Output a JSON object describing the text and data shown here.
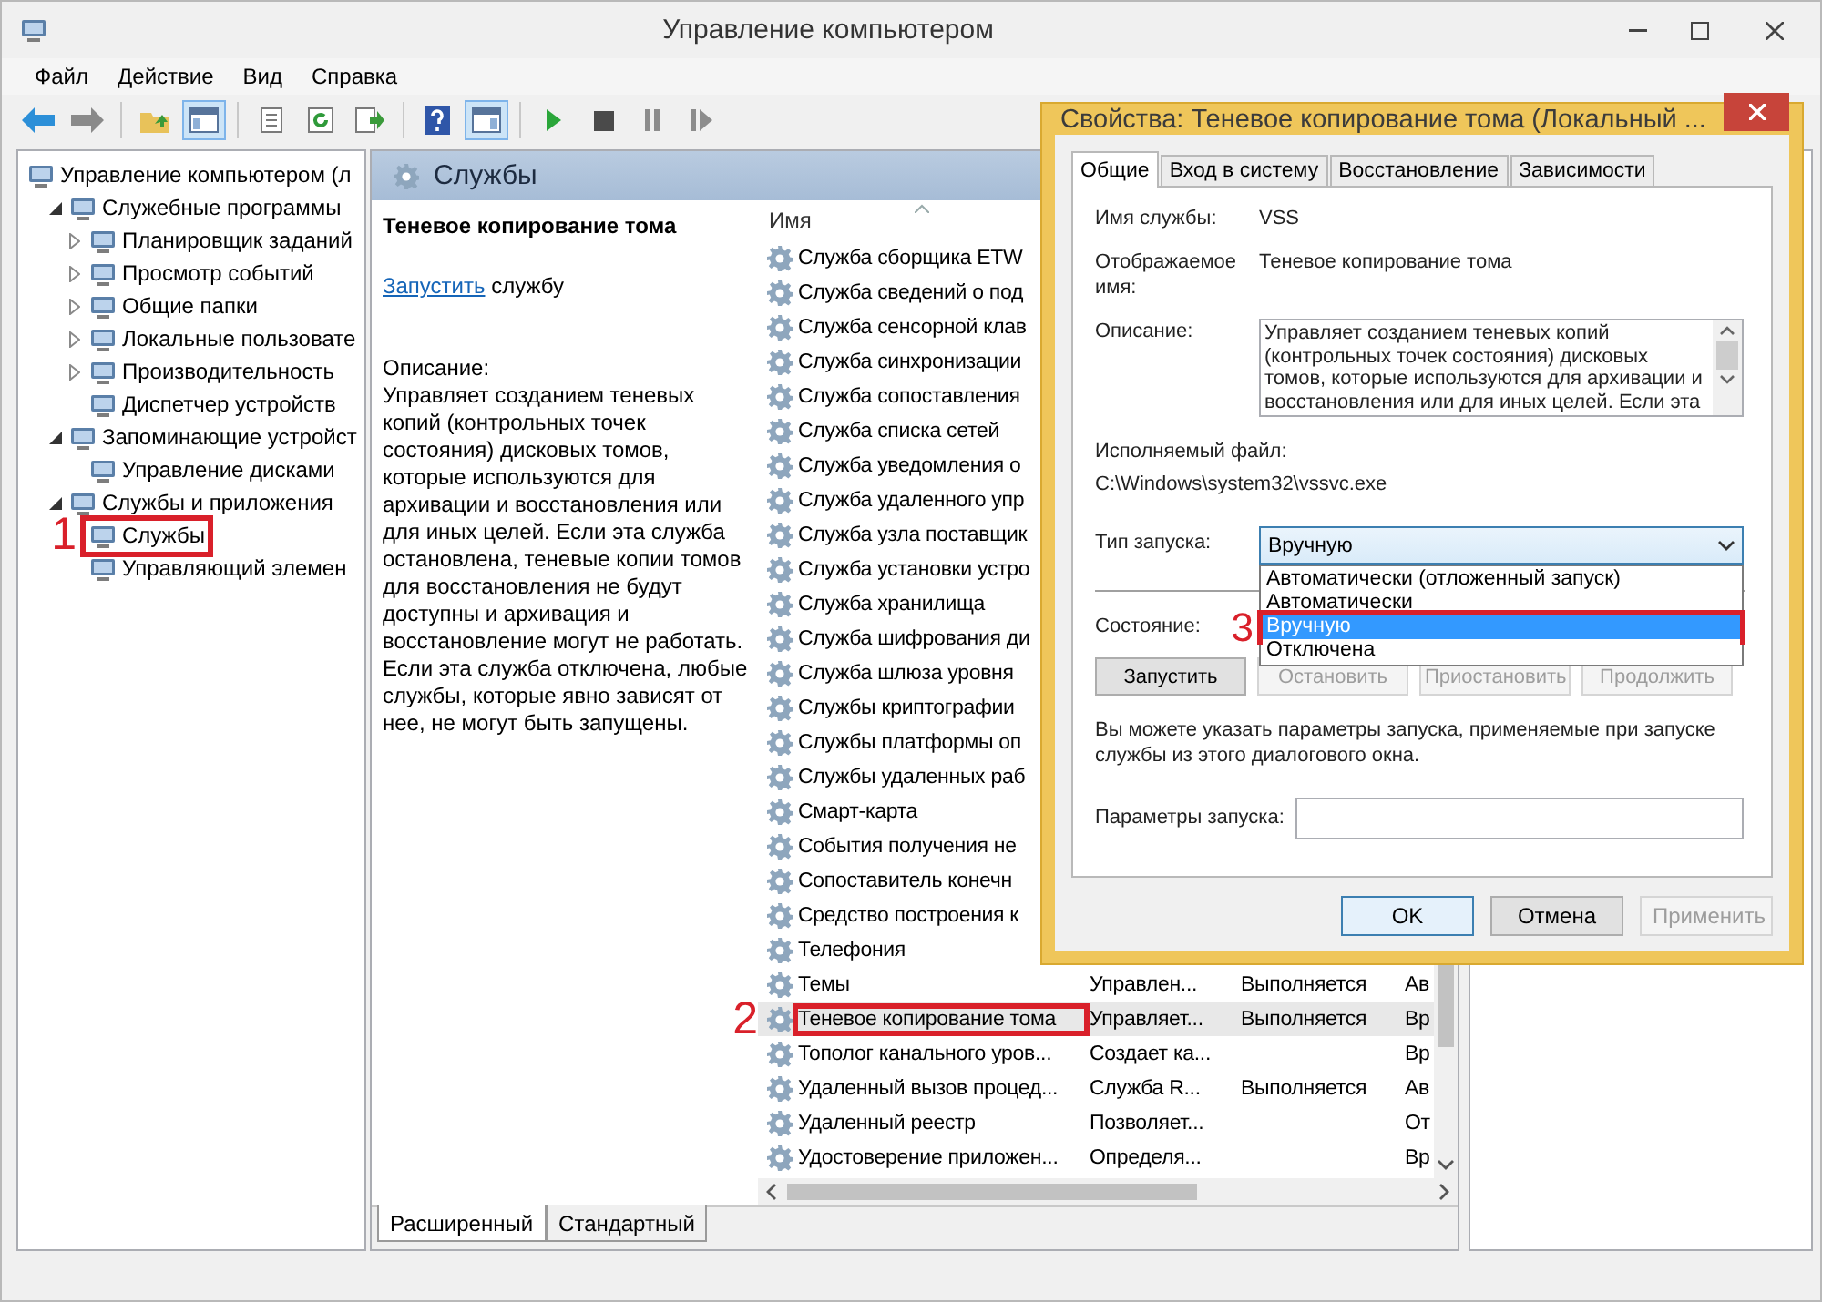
{
  "window": {
    "title": "Управление компьютером"
  },
  "menu": [
    "Файл",
    "Действие",
    "Вид",
    "Справка"
  ],
  "toolbar": [
    {
      "kind": "back",
      "on": false
    },
    {
      "kind": "forward",
      "on": false
    },
    {
      "kind": "separator"
    },
    {
      "kind": "up",
      "on": false
    },
    {
      "kind": "tree",
      "on": true
    },
    {
      "kind": "separator"
    },
    {
      "kind": "properties",
      "on": false
    },
    {
      "kind": "refresh",
      "on": false
    },
    {
      "kind": "export",
      "on": false
    },
    {
      "kind": "separator"
    },
    {
      "kind": "help",
      "on": false
    },
    {
      "kind": "actions",
      "on": true
    },
    {
      "kind": "separator"
    },
    {
      "kind": "play",
      "on": false
    },
    {
      "kind": "stop",
      "on": false
    },
    {
      "kind": "pause",
      "on": false
    },
    {
      "kind": "resume",
      "on": false
    }
  ],
  "tree": {
    "label": "Управление компьютером (л",
    "children": [
      {
        "label": "Служебные программы",
        "expanded": true,
        "children": [
          {
            "label": "Планировщик заданий",
            "expanded": false
          },
          {
            "label": "Просмотр событий",
            "expanded": false
          },
          {
            "label": "Общие папки",
            "expanded": false
          },
          {
            "label": "Локальные пользовате",
            "expanded": false
          },
          {
            "label": "Производительность",
            "expanded": false
          },
          {
            "label": "Диспетчер устройств"
          }
        ]
      },
      {
        "label": "Запоминающие устройст",
        "expanded": true,
        "children": [
          {
            "label": "Управление дисками"
          }
        ]
      },
      {
        "label": "Службы и приложения",
        "expanded": true,
        "children": [
          {
            "label": "Службы",
            "callout": "1"
          },
          {
            "label": "Управляющий элемен"
          }
        ]
      }
    ]
  },
  "services_panel": {
    "title": "Службы",
    "details": {
      "name": "Теневое копирование тома",
      "action_link": "Запустить",
      "action_rest": "службу",
      "description_label": "Описание:",
      "description": "Управляет созданием теневых копий (контрольных точек состояния) дисковых томов, которые используются для архивации и восстановления или для иных целей. Если эта служба остановлена, теневые копии томов для восстановления не будут доступны и архивация и восстановление могут не работать. Если эта служба отключена, любые службы, которые явно зависят от нее, не могут быть запущены."
    },
    "table": {
      "columns": [
        "Имя"
      ],
      "rows": [
        {
          "name": "Служба сборщика ETW",
          "selected": false
        },
        {
          "name": "Служба сведений о под",
          "selected": false
        },
        {
          "name": "Служба сенсорной клав",
          "selected": false
        },
        {
          "name": "Служба синхронизации",
          "selected": false
        },
        {
          "name": "Служба сопоставления",
          "selected": false
        },
        {
          "name": "Служба списка сетей",
          "selected": false
        },
        {
          "name": "Служба уведомления о",
          "selected": false
        },
        {
          "name": "Служба удаленного упр",
          "selected": false
        },
        {
          "name": "Служба узла поставщик",
          "selected": false
        },
        {
          "name": "Служба установки устро",
          "selected": false
        },
        {
          "name": "Служба хранилища",
          "selected": false
        },
        {
          "name": "Служба шифрования ди",
          "selected": false
        },
        {
          "name": "Служба шлюза уровня",
          "selected": false
        },
        {
          "name": "Службы криптографии",
          "selected": false
        },
        {
          "name": "Службы платформы оп",
          "selected": false
        },
        {
          "name": "Службы удаленных раб",
          "selected": false
        },
        {
          "name": "Смарт-карта",
          "selected": false
        },
        {
          "name": "События получения не",
          "selected": false
        },
        {
          "name": "Сопоставитель конечн",
          "selected": false
        },
        {
          "name": "Средство построения к",
          "selected": false
        },
        {
          "name": "Телефония",
          "selected": false
        },
        {
          "name": "Темы",
          "column_2": "Управлен...",
          "column_3": "Выполняется",
          "column_4": "Ав",
          "selected": false
        },
        {
          "name": "Теневое копирование тома",
          "column_2": "Управляет...",
          "column_3": "Выполняется",
          "column_4": "Вр",
          "selected": true,
          "callout": "2"
        },
        {
          "name": "Тополог канального уров...",
          "column_2": "Создает ка...",
          "column_4": "Вр",
          "selected": false
        },
        {
          "name": "Удаленный вызов процед...",
          "column_2": "Служба R...",
          "column_3": "Выполняется",
          "column_4": "Ав",
          "selected": false
        },
        {
          "name": "Удаленный реестр",
          "column_2": "Позволяет...",
          "column_4": "От",
          "selected": false
        },
        {
          "name": "Удостоверение приложен...",
          "column_2": "Определя...",
          "column_4": "Вр",
          "selected": false
        }
      ]
    },
    "view_tabs": [
      {
        "label": "Расширенный",
        "selected": true
      },
      {
        "label": "Стандартный",
        "selected": false
      }
    ]
  },
  "dialog": {
    "title": "Свойства: Теневое копирование тома (Локальный ...",
    "tabs": [
      {
        "label": "Общие",
        "selected": true
      },
      {
        "label": "Вход в систему",
        "selected": false
      },
      {
        "label": "Восстановление",
        "selected": false
      },
      {
        "label": "Зависимости",
        "selected": false
      }
    ],
    "fields": [
      {
        "label": "Имя службы:",
        "value": "VSS"
      },
      {
        "label": "Отображаемое имя:",
        "value": "Теневое копирование тома"
      }
    ],
    "description": {
      "label": "Описание:",
      "value": "Управляет созданием теневых копий (контрольных точек состояния) дисковых томов, которые используются для архивации и восстановления или для иных целей. Если эта"
    },
    "executable": {
      "label": "Исполняемый файл:",
      "value": "C:\\Windows\\system32\\vssvc.exe"
    },
    "startup_type": {
      "label": "Тип запуска:",
      "value": "Вручную",
      "expanded": true,
      "options": [
        {
          "label": "Автоматически (отложенный запуск)",
          "selected": false
        },
        {
          "label": "Автоматически",
          "selected": false
        },
        {
          "label": "Вручную",
          "selected": true,
          "callout": "3"
        },
        {
          "label": "Отключена",
          "selected": false
        }
      ]
    },
    "status": {
      "label": "Состояние:"
    },
    "service_buttons": [
      {
        "label": "Запустить",
        "disabled": false
      },
      {
        "label": "Остановить",
        "disabled": true
      },
      {
        "label": "Приостановить",
        "disabled": true
      },
      {
        "label": "Продолжить",
        "disabled": true
      }
    ],
    "hint": "Вы можете указать параметры запуска, применяемые при запуске службы из этого диалогового окна.",
    "start_params": {
      "label": "Параметры запуска:"
    },
    "buttons": [
      {
        "label": "OK",
        "default": true,
        "disabled": false
      },
      {
        "label": "Отмена",
        "default": false,
        "disabled": false
      },
      {
        "label": "Применить",
        "default": false,
        "disabled": true
      }
    ]
  }
}
